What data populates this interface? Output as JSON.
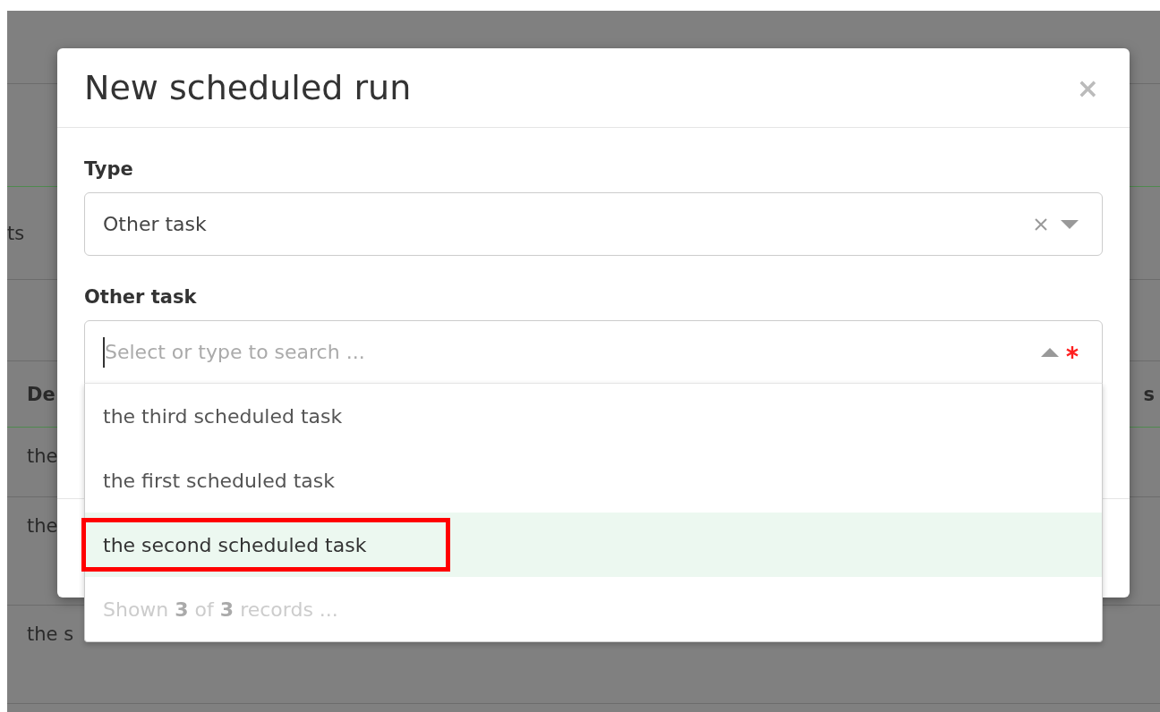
{
  "background_page": {
    "section_label": "ts",
    "table": {
      "header": [
        "De",
        "s"
      ],
      "rows": [
        [
          "the"
        ],
        [
          "the"
        ],
        [
          "the s"
        ]
      ]
    }
  },
  "modal": {
    "title": "New scheduled run",
    "close": "×",
    "fields": [
      {
        "kind": "select",
        "label": "Type",
        "value": "Other task",
        "clearable": true,
        "open": false,
        "required": false
      },
      {
        "kind": "search",
        "label": "Other task",
        "placeholder": "Select or type to search ...",
        "clearable": false,
        "open": true,
        "required": true,
        "options": [
          {
            "label": "the third scheduled task",
            "selected": false,
            "annotated": false
          },
          {
            "label": "the first scheduled task",
            "selected": false,
            "annotated": false
          },
          {
            "label": "the second scheduled task",
            "selected": true,
            "annotated": true
          }
        ],
        "footer": "Shown **3** of **3** records ..."
      }
    ]
  }
}
